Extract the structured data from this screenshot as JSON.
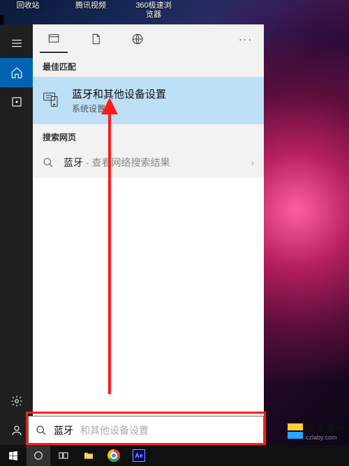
{
  "desktop": {
    "icons": [
      "回收站",
      "腾讯视频",
      "360极速浏览器"
    ]
  },
  "rail": {
    "hamburger": "menu-icon",
    "home": "home-icon",
    "doc": "document-icon",
    "gear": "gear-icon",
    "feedback": "feedback-icon"
  },
  "tabs": {
    "all": "all-apps-icon",
    "docs": "documents-icon",
    "web": "web-icon",
    "more": "···"
  },
  "sections": {
    "best_match": "最佳匹配",
    "search_web": "搜索网页"
  },
  "best_result": {
    "query": "蓝牙",
    "suffix": "和其他设备设置",
    "sub": "系统设置"
  },
  "web_result": {
    "query": "蓝牙",
    "hint": " - 查看网络搜索结果",
    "chevron": "›"
  },
  "search": {
    "typed": "蓝牙",
    "ghost": "和其他设备设置"
  },
  "watermark": {
    "brand": "纯净基地",
    "url": "czlaby.com"
  },
  "taskbar": {
    "ae_label": "Ae"
  }
}
